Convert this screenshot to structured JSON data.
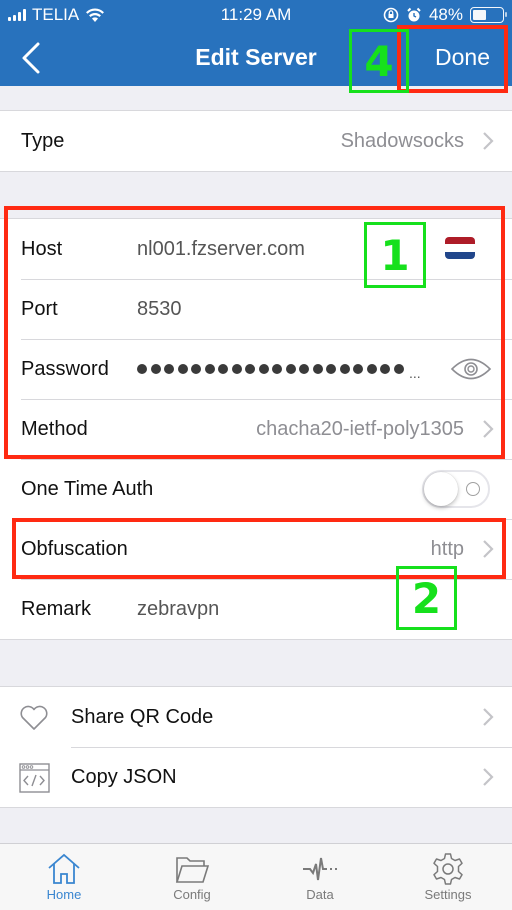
{
  "status_bar": {
    "carrier": "TELIA",
    "time": "11:29 AM",
    "battery_percent": "48%",
    "battery_level": 0.48,
    "icons": [
      "signal-icon",
      "wifi-icon",
      "orientation-lock-icon",
      "alarm-icon",
      "battery-icon"
    ]
  },
  "nav": {
    "title": "Edit Server",
    "back_icon": "chevron-left-icon",
    "done_label": "Done"
  },
  "type_row": {
    "label": "Type",
    "value": "Shadowsocks"
  },
  "server": {
    "host": {
      "label": "Host",
      "value": "nl001.fzserver.com",
      "flag": {
        "country": "Netherlands",
        "colors": [
          "#ae1c28",
          "#ffffff",
          "#21468b"
        ]
      }
    },
    "port": {
      "label": "Port",
      "value": "8530"
    },
    "password": {
      "label": "Password",
      "masked_dots": 20,
      "ellipsis": "...",
      "reveal_icon": "eye-icon"
    },
    "method": {
      "label": "Method",
      "value": "chacha20-ietf-poly1305"
    },
    "one_time_auth": {
      "label": "One Time Auth",
      "enabled": false
    },
    "obfuscation": {
      "label": "Obfuscation",
      "value": "http"
    },
    "remark": {
      "label": "Remark",
      "value": "zebravpn"
    }
  },
  "actions": [
    {
      "label": "Share QR Code",
      "icon": "heart-icon"
    },
    {
      "label": "Copy JSON",
      "icon": "code-window-icon"
    }
  ],
  "tabbar": {
    "items": [
      {
        "label": "Home",
        "icon": "home-icon",
        "active": true
      },
      {
        "label": "Config",
        "icon": "folder-icon",
        "active": false
      },
      {
        "label": "Data",
        "icon": "pulse-icon",
        "active": false
      },
      {
        "label": "Settings",
        "icon": "gear-icon",
        "active": false
      }
    ]
  },
  "annotations": {
    "markers": [
      "1",
      "2",
      "4"
    ],
    "colors": {
      "highlight_box": "#ff2a12",
      "step_marker": "#16e01c"
    }
  },
  "colors": {
    "nav_background": "#2872bd",
    "tab_active": "#3a86d0",
    "page_background": "#efeff4"
  }
}
